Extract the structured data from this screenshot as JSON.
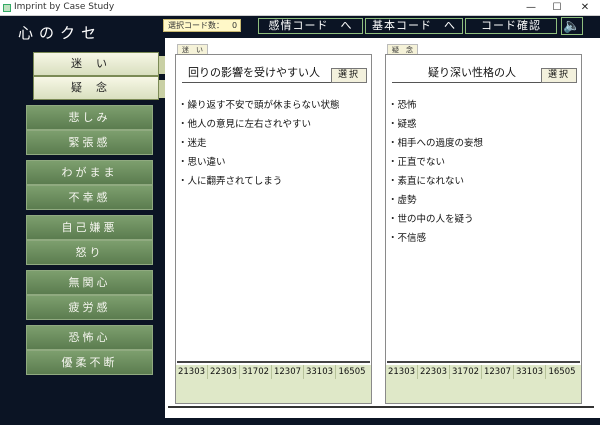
{
  "window": {
    "title": "Imprint by Case Study",
    "min": "—",
    "max": "☐",
    "close": "✕"
  },
  "app": {
    "name": "心のクセ"
  },
  "top_buttons": [
    {
      "label": "迷い"
    },
    {
      "label": "疑念"
    }
  ],
  "emotions": [
    {
      "label": "悲しみ"
    },
    {
      "label": "緊張感"
    },
    {
      "label": "わがまま"
    },
    {
      "label": "不幸感"
    },
    {
      "label": "自己嫌悪"
    },
    {
      "label": "怒り"
    },
    {
      "label": "無関心"
    },
    {
      "label": "疲労感"
    },
    {
      "label": "恐怖心"
    },
    {
      "label": "優柔不断"
    }
  ],
  "topbar": {
    "selected_label": "選択コード数：",
    "selected_value": "0",
    "nav": [
      "感情コード　へ",
      "基本コード　へ",
      "コード確認"
    ],
    "speaker_icon": "speaker-icon"
  },
  "panels": [
    {
      "tag": "迷　い",
      "title": "回りの影響を受けやすい人",
      "select_label": "選択",
      "items": [
        "・繰り返す不安で頭が休まらない状態",
        "・他人の意見に左右されやすい",
        "・迷走",
        "・思い違い",
        "・人に翻弄されてしまう"
      ],
      "codes": [
        "21303",
        "22303",
        "31702",
        "12307",
        "33103",
        "16505"
      ]
    },
    {
      "tag": "疑　念",
      "title": "疑り深い性格の人",
      "select_label": "選択",
      "items": [
        "・恐怖",
        "・疑惑",
        "・相手への過度の妄想",
        "・正直でない",
        "・素直になれない",
        "・虚勢",
        "・世の中の人を疑う",
        "・不信感"
      ],
      "codes": [
        "21303",
        "22303",
        "31702",
        "12307",
        "33103",
        "16505"
      ]
    }
  ]
}
